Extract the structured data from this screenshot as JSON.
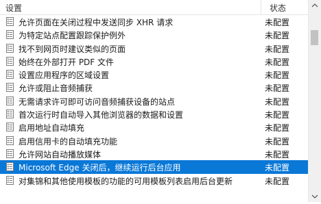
{
  "header": {
    "setting_label": "设置",
    "status_label": "状态"
  },
  "rows": [
    {
      "name": "允许页面在关闭过程中发送同步 XHR 请求",
      "status": "未配置"
    },
    {
      "name": "为特定站点配置跟踪保护例外",
      "status": "未配置"
    },
    {
      "name": "找不到网页时建议类似的页面",
      "status": "未配置"
    },
    {
      "name": "始终在外部打开 PDF 文件",
      "status": "未配置"
    },
    {
      "name": "设置应用程序的区域设置",
      "status": "未配置"
    },
    {
      "name": "允许或阻止音频捕获",
      "status": "未配置"
    },
    {
      "name": "无需请求许可即可访问音频捕获设备的站点",
      "status": "未配置"
    },
    {
      "name": "首次运行时自动导入其他浏览器的数据和设置",
      "status": "未配置"
    },
    {
      "name": "启用地址自动填充",
      "status": "未配置"
    },
    {
      "name": "启用信用卡的自动填充功能",
      "status": "未配置"
    },
    {
      "name": "允许网站自动播放媒体",
      "status": "未配置"
    },
    {
      "name": "Microsoft Edge 关闭后，继续运行后台应用",
      "status": "未配置"
    },
    {
      "name": "对集锦和其他使用模板的功能的可用模板列表启用后台更新",
      "status": "未配置"
    }
  ],
  "selected_index": 11,
  "icons": {
    "policy": "policy-setting-icon"
  },
  "colors": {
    "selection": "#0a78d7"
  }
}
